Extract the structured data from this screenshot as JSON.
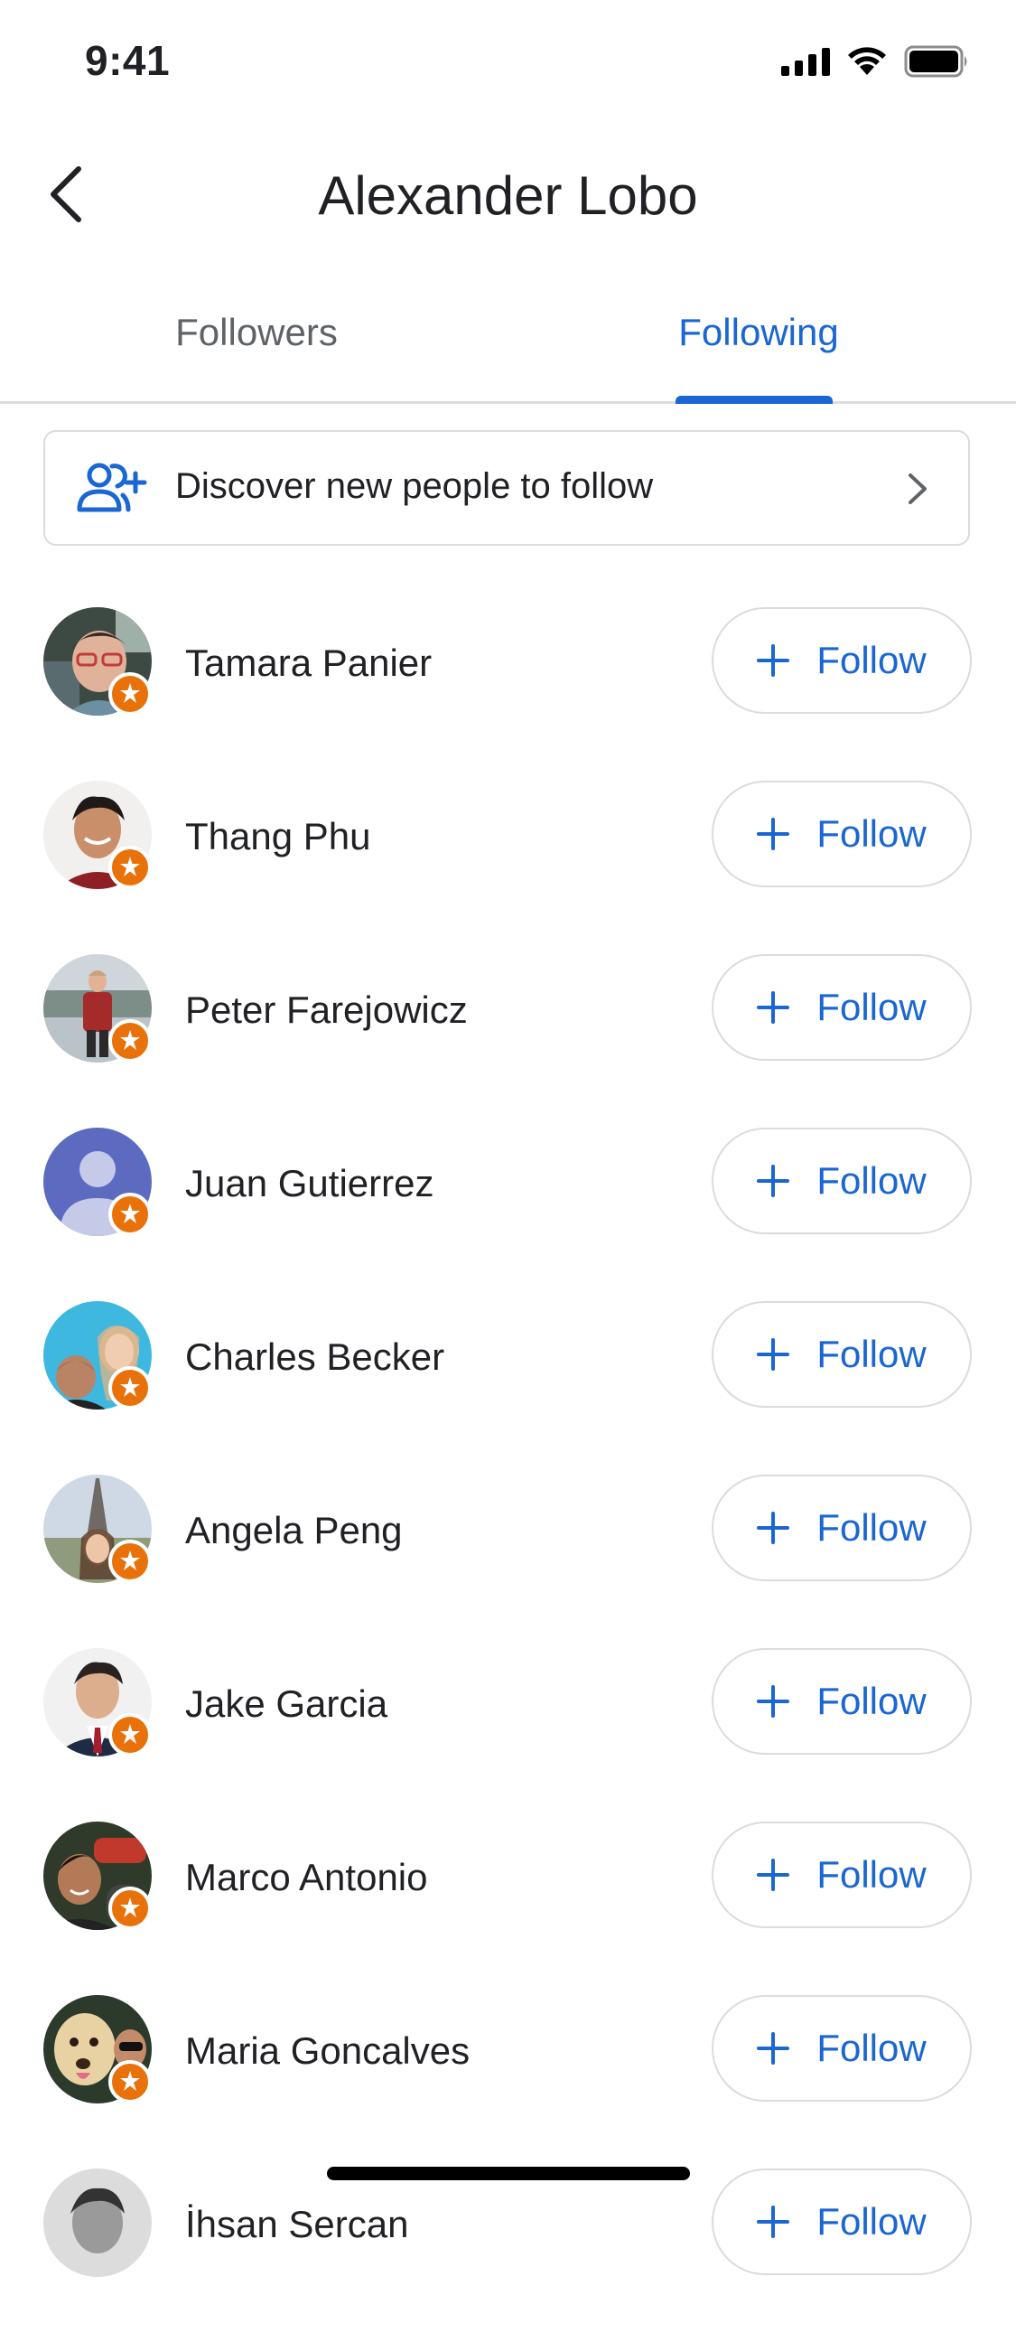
{
  "status_bar": {
    "time": "9:41"
  },
  "header": {
    "title": "Alexander Lobo",
    "back_icon": "chevron-left-icon"
  },
  "tabs": [
    {
      "label": "Followers",
      "active": false
    },
    {
      "label": "Following",
      "active": true
    }
  ],
  "discover": {
    "label": "Discover new people to follow",
    "icon": "person-add-icon"
  },
  "colors": {
    "accent": "#1a66d2",
    "badge": "#e8710a",
    "divider": "#dadce0"
  },
  "people": [
    {
      "name": "Tamara Panier",
      "button": "Follow",
      "avatar": "photo"
    },
    {
      "name": "Thang Phu",
      "button": "Follow",
      "avatar": "photo"
    },
    {
      "name": "Peter Farejowicz",
      "button": "Follow",
      "avatar": "photo"
    },
    {
      "name": "Juan Gutierrez",
      "button": "Follow",
      "avatar": "default-person-icon"
    },
    {
      "name": "Charles Becker",
      "button": "Follow",
      "avatar": "photo"
    },
    {
      "name": "Angela Peng",
      "button": "Follow",
      "avatar": "photo"
    },
    {
      "name": "Jake Garcia",
      "button": "Follow",
      "avatar": "photo"
    },
    {
      "name": "Marco Antonio",
      "button": "Follow",
      "avatar": "photo"
    },
    {
      "name": "Maria Goncalves",
      "button": "Follow",
      "avatar": "photo"
    },
    {
      "name": "İhsan Sercan",
      "button": "Follow",
      "avatar": "photo"
    }
  ]
}
